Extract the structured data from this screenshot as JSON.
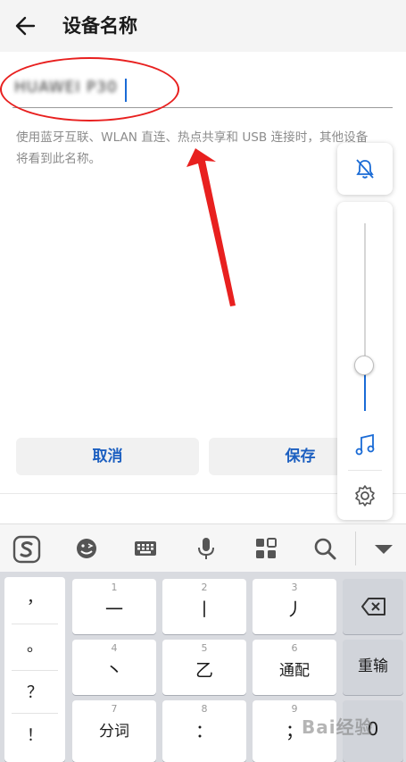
{
  "header": {
    "title": "设备名称",
    "back_icon": "arrow-left-icon"
  },
  "name_field": {
    "value": "HUAWEI P30"
  },
  "hint_text": "使用蓝牙互联、WLAN 直连、热点共享和 USB 连接时，其他设备将看到此名称。",
  "buttons": {
    "cancel": "取消",
    "save": "保存"
  },
  "accent_color": "#1a6bd6",
  "annotation_color": "#e8201f",
  "volume_panel": {
    "mute_icon": "bell-off-icon",
    "media_icon": "music-note-icon",
    "settings_icon": "gear-icon",
    "level": 0.25
  },
  "keyboard_toolbar": {
    "icons": [
      "sogou-logo-icon",
      "emoji-icon",
      "keyboard-icon",
      "microphone-icon",
      "grid-icon",
      "search-icon",
      "collapse-icon"
    ]
  },
  "keyboard": {
    "punctuation": [
      "，",
      "。",
      "？",
      "！"
    ],
    "rows": [
      [
        {
          "num": "1",
          "label": "一"
        },
        {
          "num": "2",
          "label": "丨"
        },
        {
          "num": "3",
          "label": "丿"
        }
      ],
      [
        {
          "num": "4",
          "label": "丶"
        },
        {
          "num": "5",
          "label": "乙"
        },
        {
          "num": "6",
          "label": "通配"
        }
      ],
      [
        {
          "num": "7",
          "label": "分词"
        },
        {
          "num": "8",
          "label": "："
        },
        {
          "num": "9",
          "label": "；"
        }
      ]
    ],
    "delete_icon": "backspace-icon",
    "reenter_label": "重输",
    "zero_label": "0"
  },
  "watermark": "Bai经验"
}
